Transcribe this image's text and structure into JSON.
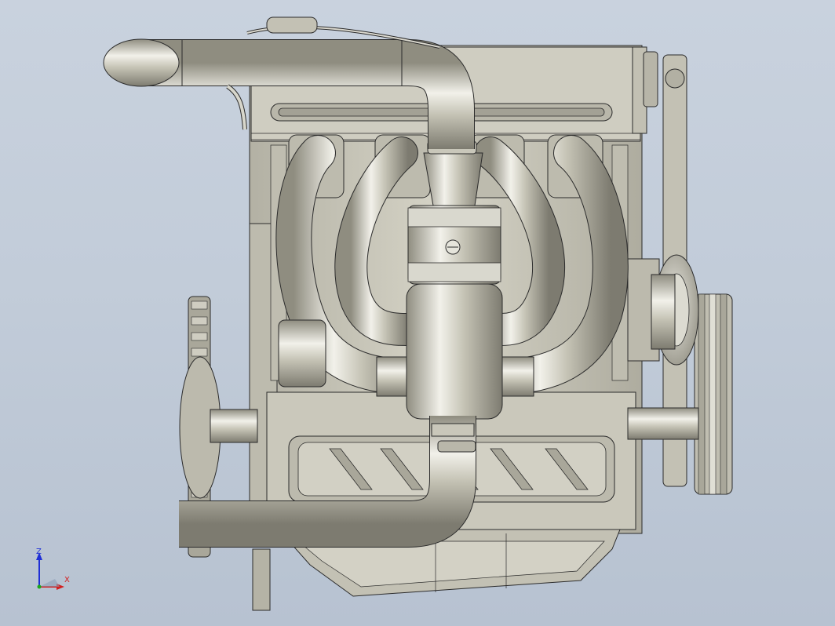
{
  "viewport": {
    "background_top": "#c9d2de",
    "background_bottom": "#b7c2d1",
    "model_fill": "#c5c3b5",
    "model_shadow": "#8f8d80",
    "model_highlight": "#f2f1ea",
    "edge_color": "#2b2b2b"
  },
  "triad": {
    "z_label": "Z",
    "x_label": "X",
    "z_color": "#1f2fd6",
    "x_color": "#d21f1f",
    "y_color": "#1aa81a"
  }
}
